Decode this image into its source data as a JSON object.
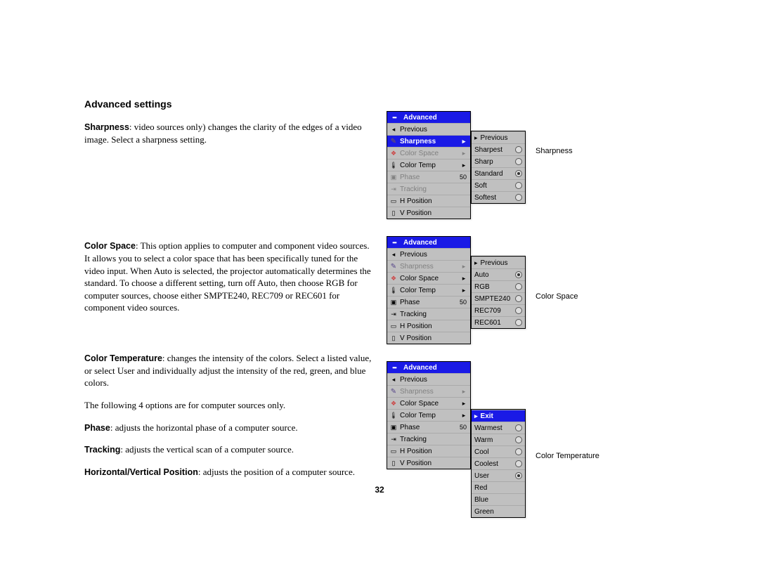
{
  "heading": "Advanced settings",
  "para_sharpness": ": video sources only) changes the clarity of the edges of a video image. Select a sharpness setting.",
  "para_sharpness_b": "Sharpness",
  "para_colorspace_b": "Color Space",
  "para_colorspace": ": This option applies to computer and component video sources. It allows you to select a color space that has been specifically tuned for the video input. When Auto is selected, the projector automatically determines the standard. To choose a different setting, turn off Auto, then choose RGB for computer sources, choose either SMPTE240, REC709 or REC601 for component video sources.",
  "para_colortemp_b": "Color Temperature",
  "para_colortemp": ": changes the intensity of the colors. Select a listed value, or select User and individually adjust the intensity of the red, green, and blue colors.",
  "para_following": "The following 4 options are for computer sources only.",
  "para_phase_b": "Phase",
  "para_phase": ": adjusts the horizontal phase of a computer source.",
  "para_tracking_b": "Tracking",
  "para_tracking": ": adjusts the vertical scan of a computer source.",
  "para_hvpos_b": "Horizontal/Vertical Position",
  "para_hvpos": ": adjusts the position of a computer source.",
  "page_number": "32",
  "menu": {
    "title": "Advanced",
    "prev": "Previous",
    "items": {
      "sharpness": "Sharpness",
      "colorspace": "Color Space",
      "colortemp": "Color Temp",
      "phase": "Phase",
      "phase_val": "50",
      "tracking": "Tracking",
      "hpos": "H Position",
      "vpos": "V Position"
    }
  },
  "sharpness_submenu": {
    "prev": "Previous",
    "options": [
      "Sharpest",
      "Sharp",
      "Standard",
      "Soft",
      "Softest"
    ],
    "selected": "Standard"
  },
  "colorspace_submenu": {
    "prev": "Previous",
    "options": [
      "Auto",
      "RGB",
      "SMPTE240",
      "REC709",
      "REC601"
    ],
    "selected": "Auto"
  },
  "colortemp_submenu": {
    "exit": "Exit",
    "options": [
      "Warmest",
      "Warm",
      "Cool",
      "Coolest",
      "User",
      "Red",
      "Blue",
      "Green"
    ],
    "selected": "User"
  },
  "captions": {
    "sharpness": "Sharpness",
    "colorspace": "Color Space",
    "colortemp": "Color Temperature"
  }
}
